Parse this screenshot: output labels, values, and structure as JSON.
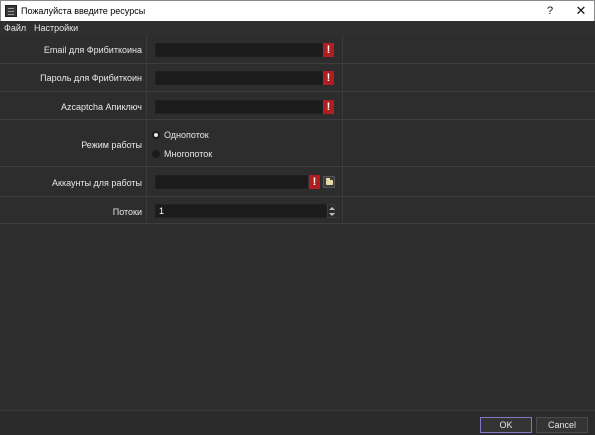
{
  "window": {
    "title": "Пожалуйста введите ресурсы",
    "help": "?",
    "close": "✕"
  },
  "menu": {
    "items": [
      "Файл",
      "Настройки"
    ]
  },
  "form": {
    "email": {
      "label": "Email для Фрибиткоина",
      "value": "",
      "required": true
    },
    "password": {
      "label": "Пароль для Фрибиткоин",
      "value": "",
      "required": true
    },
    "azcaptcha": {
      "label": "Azcaptcha Апиключ",
      "value": "",
      "required": true
    },
    "mode": {
      "label": "Режим работы",
      "options": [
        "Однопоток",
        "Многопоток"
      ],
      "selected": "Однопоток"
    },
    "accounts": {
      "label": "Аккаунты для работы",
      "value": "",
      "required": true
    },
    "threads": {
      "label": "Потоки",
      "value": "1"
    },
    "warn_glyph": "!"
  },
  "footer": {
    "ok": "OK",
    "cancel": "Cancel"
  },
  "colors": {
    "warn": "#b01e22",
    "ok_border": "#8a76c8",
    "background": "#2d2d2d",
    "field": "#1b1b1b"
  }
}
